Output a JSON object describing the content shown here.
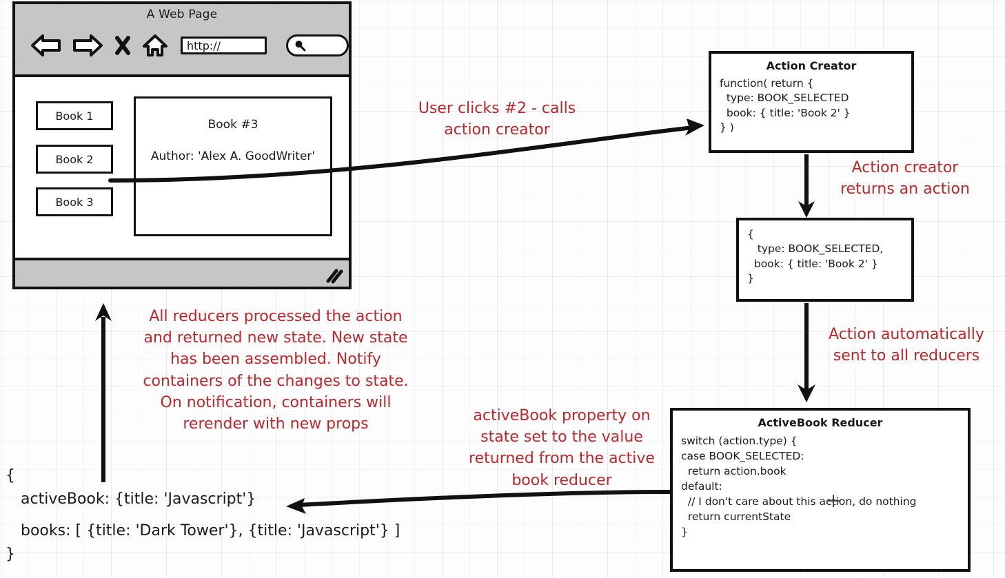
{
  "browser": {
    "title": "A Web Page",
    "toolbar": {
      "back_icon": "back-arrow-icon",
      "forward_icon": "forward-arrow-icon",
      "stop_icon": "close-x-icon",
      "home_icon": "home-icon",
      "url_value": "http://",
      "url_placeholder": "http://",
      "search_icon": "search-icon",
      "search_value": "",
      "search_placeholder": ""
    },
    "books": [
      {
        "label": "Book 1"
      },
      {
        "label": "Book 2"
      },
      {
        "label": "Book 3"
      }
    ],
    "detail": {
      "title": "Book #3",
      "author": "Author: 'Alex A. GoodWriter'"
    },
    "statusbar": {
      "resize_grip_icon": "resize-grip-icon"
    }
  },
  "boxes": {
    "action_creator": {
      "title": "Action Creator",
      "code": "function( return {\n  type: BOOK_SELECTED\n  book: { title: 'Book 2' }\n} )"
    },
    "action_object": {
      "code": "{\n   type: BOOK_SELECTED,\n  book: { title: 'Book 2' }\n}"
    },
    "reducer": {
      "title": "ActiveBook Reducer",
      "code": "switch (action.type) {\ncase BOOK_SELECTED:\n  return action.book\ndefault:\n  // I don't care about this action, do nothing\n  return currentState\n}"
    }
  },
  "notes": {
    "user_clicks": "User clicks #2 - calls\naction creator",
    "returns_action": "Action creator\nreturns an action",
    "auto_sent": "Action automatically\nsent to all reducers",
    "all_reducers": "All reducers processed the action\nand returned new state.  New state\nhas been assembled.  Notify\ncontainers of the changes to state.\nOn notification, containers will\nrerender with new props",
    "activebook": "activeBook property on\nstate set to the value\nreturned from the active\nbook reducer"
  },
  "state_object": {
    "open_brace": "{",
    "active_book": "activeBook: {title: 'Javascript'}",
    "books": "books: [ {title: 'Dark Tower'}, {title: 'Javascript'} ]",
    "close_brace": "}"
  },
  "colors": {
    "annotation_red": "#c0262a",
    "stroke_black": "#111111",
    "chrome_gray": "#c6c6c6",
    "grid_line": "#ececec",
    "canvas_bg": "#fdfdfd"
  },
  "cursor": {
    "icon": "crosshair-cursor-icon"
  }
}
